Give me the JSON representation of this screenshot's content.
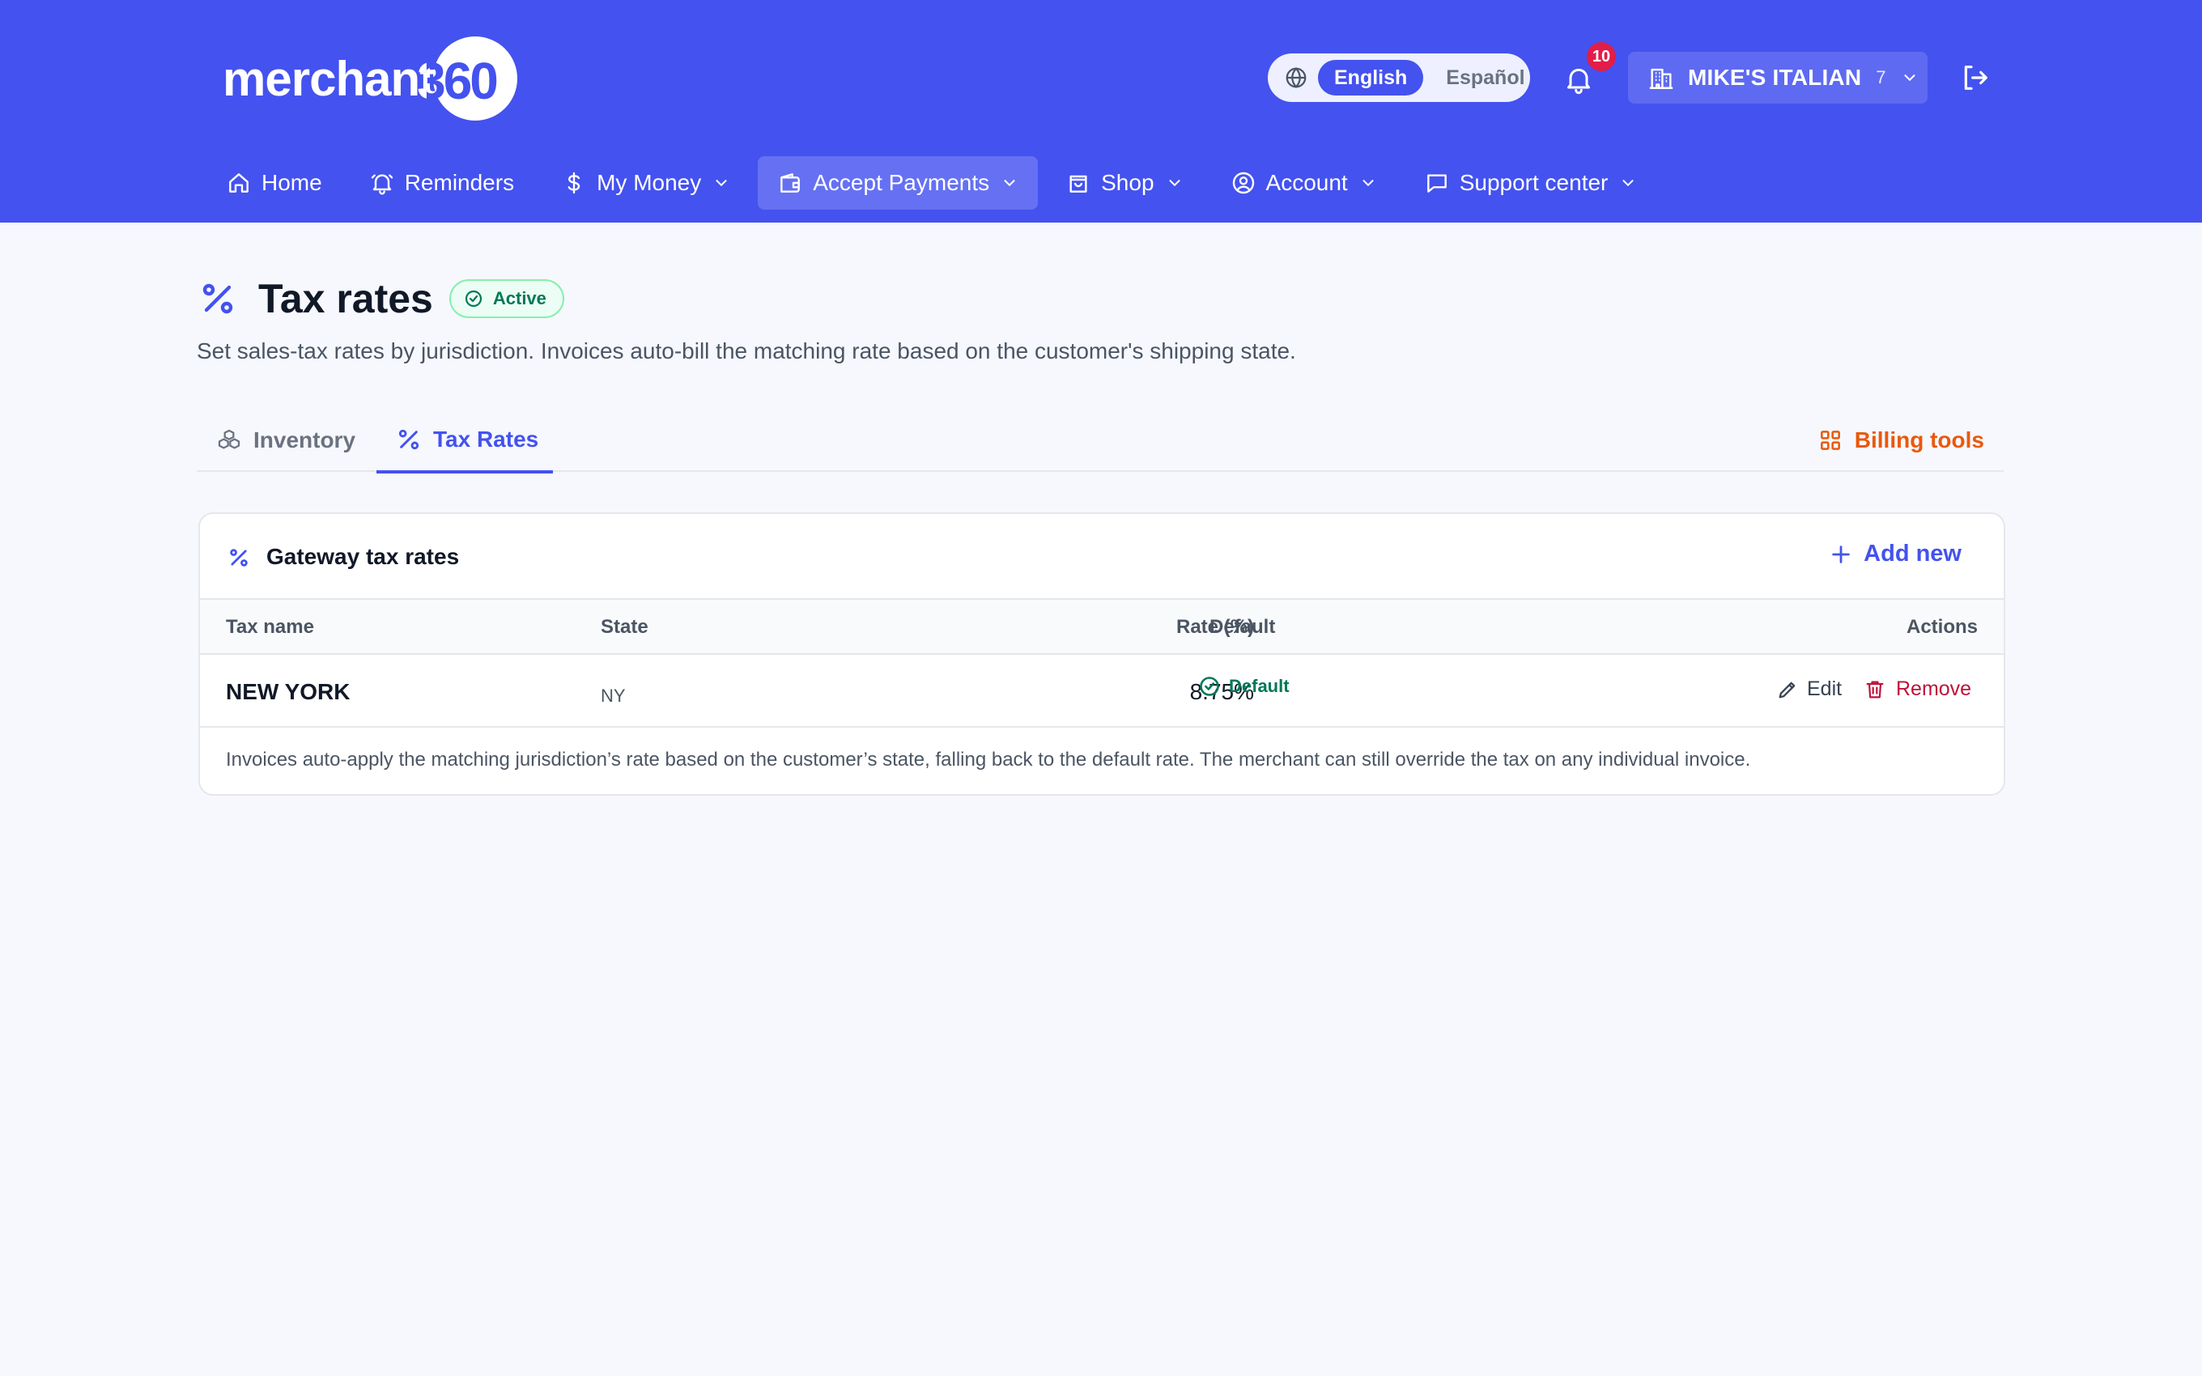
{
  "header": {
    "logo": {
      "text": "merchant",
      "number": "360"
    },
    "language": {
      "active": "English",
      "other": "Español"
    },
    "notifications": {
      "count": "10"
    },
    "store": {
      "name": "MIKE'S ITALIAN",
      "count": "7"
    },
    "nav": [
      {
        "label": "Home",
        "icon": "home-icon"
      },
      {
        "label": "Reminders",
        "icon": "bell-icon"
      },
      {
        "label": "My Money",
        "icon": "dollar-icon"
      },
      {
        "label": "Accept Payments",
        "icon": "wallet-icon"
      },
      {
        "label": "Shop",
        "icon": "bag-icon"
      },
      {
        "label": "Account",
        "icon": "user-circle-icon"
      },
      {
        "label": "Support center",
        "icon": "chat-icon"
      }
    ],
    "active_nav": "Accept Payments"
  },
  "page": {
    "title": "Tax rates",
    "status": "Active",
    "subtitle": "Set sales-tax rates by jurisdiction. Invoices auto-bill the matching rate based on the customer's shipping state."
  },
  "tabs": [
    {
      "label": "Inventory",
      "icon": "cubes-icon"
    },
    {
      "label": "Tax Rates",
      "icon": "percent-icon"
    }
  ],
  "active_tab": "Tax Rates",
  "billing_tools": "Billing tools",
  "card": {
    "title": "Gateway tax rates",
    "add_label": "Add new",
    "columns": {
      "name": "Tax name",
      "state": "State",
      "rate": "Rate (%)",
      "default": "Default",
      "actions": "Actions"
    },
    "rows": [
      {
        "name": "NEW YORK",
        "state": "NY",
        "rate": "8.75%",
        "default": "Default",
        "edit": "Edit",
        "remove": "Remove"
      }
    ],
    "note": "Invoices auto-apply the matching jurisdiction’s rate based on the customer’s state, falling back to the default rate. The merchant can still override the tax on any individual invoice."
  },
  "colors": {
    "brand": "#4452ef",
    "success": "#047857",
    "danger": "#be123c",
    "accent": "#ea580c"
  }
}
